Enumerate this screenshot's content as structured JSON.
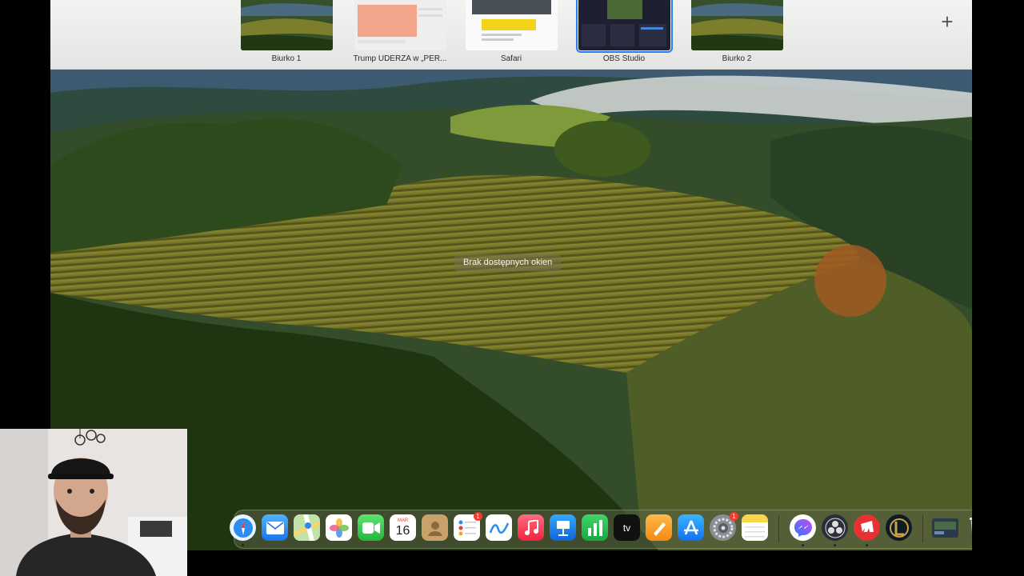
{
  "spaces": [
    {
      "label": "Biurko 1"
    },
    {
      "label": "Trump UDERZA w „PER..."
    },
    {
      "label": "Safari"
    },
    {
      "label": "OBS Studio"
    },
    {
      "label": "Biurko 2"
    }
  ],
  "add_space_icon": "plus-icon",
  "tooltip": "Brak dostępnych okien",
  "dock": {
    "calendar_month": "MAR",
    "calendar_day": "16",
    "reminders_badge": "1",
    "settings_badge": "1",
    "appletv_label": "tv",
    "icons": [
      "safari-icon",
      "mail-icon",
      "maps-icon",
      "photos-icon",
      "facetime-icon",
      "calendar-icon",
      "contacts-icon",
      "reminders-icon",
      "freeform-icon",
      "music-icon",
      "keynote-icon",
      "numbers-icon",
      "apple-tv-icon",
      "pages-icon",
      "app-store-icon",
      "system-settings-icon",
      "notes-icon",
      "messenger-icon",
      "obs-icon",
      "riot-icon",
      "league-of-legends-icon",
      "screenshot-thumbnail-icon",
      "trash-icon"
    ]
  },
  "colors": {
    "accent": "#2a7cf6",
    "badge": "#f23a2f"
  }
}
